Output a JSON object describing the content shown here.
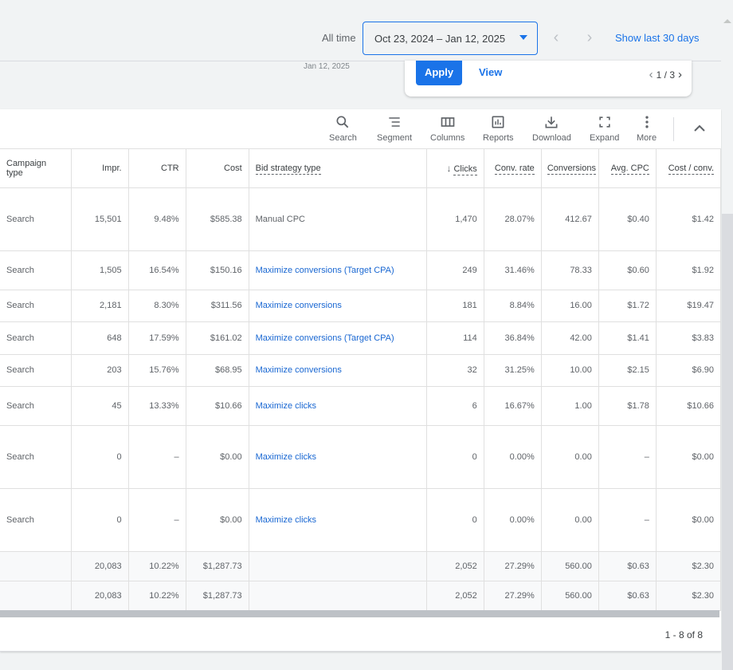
{
  "date_bar": {
    "preset_label": "All time",
    "range_value": "Oct 23, 2024 – Jan 12, 2025",
    "show_last_label": "Show last 30 days",
    "sub_date": "Jan 12, 2025"
  },
  "popup": {
    "apply_label": "Apply",
    "view_label": "View",
    "pager": "1 / 3"
  },
  "toolbar": {
    "items": [
      {
        "label": "Search",
        "icon": "search-icon"
      },
      {
        "label": "Segment",
        "icon": "segment-icon"
      },
      {
        "label": "Columns",
        "icon": "columns-icon"
      },
      {
        "label": "Reports",
        "icon": "reports-icon"
      },
      {
        "label": "Download",
        "icon": "download-icon"
      },
      {
        "label": "Expand",
        "icon": "expand-icon"
      },
      {
        "label": "More",
        "icon": "more-vert-icon"
      }
    ]
  },
  "table": {
    "columns": [
      "Campaign type",
      "Impr.",
      "CTR",
      "Cost",
      "Bid strategy type",
      "Clicks",
      "Conv. rate",
      "Conversions",
      "Avg. CPC",
      "Cost / conv."
    ],
    "sorted_column": "Clicks",
    "rows": [
      [
        "Search",
        "15,501",
        "9.48%",
        "$585.38",
        "Manual CPC",
        "1,470",
        "28.07%",
        "412.67",
        "$0.40",
        "$1.42"
      ],
      [
        "Search",
        "1,505",
        "16.54%",
        "$150.16",
        "Maximize conversions (Target CPA)",
        "249",
        "31.46%",
        "78.33",
        "$0.60",
        "$1.92"
      ],
      [
        "Search",
        "2,181",
        "8.30%",
        "$311.56",
        "Maximize conversions",
        "181",
        "8.84%",
        "16.00",
        "$1.72",
        "$19.47"
      ],
      [
        "Search",
        "648",
        "17.59%",
        "$161.02",
        "Maximize conversions (Target CPA)",
        "114",
        "36.84%",
        "42.00",
        "$1.41",
        "$3.83"
      ],
      [
        "Search",
        "203",
        "15.76%",
        "$68.95",
        "Maximize conversions",
        "32",
        "31.25%",
        "10.00",
        "$2.15",
        "$6.90"
      ],
      [
        "Search",
        "45",
        "13.33%",
        "$10.66",
        "Maximize clicks",
        "6",
        "16.67%",
        "1.00",
        "$1.78",
        "$10.66"
      ],
      [
        "Search",
        "0",
        "–",
        "$0.00",
        "Maximize clicks",
        "0",
        "0.00%",
        "0.00",
        "–",
        "$0.00"
      ],
      [
        "Search",
        "0",
        "–",
        "$0.00",
        "Maximize clicks",
        "0",
        "0.00%",
        "0.00",
        "–",
        "$0.00"
      ]
    ],
    "totals": [
      [
        "",
        "20,083",
        "10.22%",
        "$1,287.73",
        "",
        "2,052",
        "27.29%",
        "560.00",
        "$0.63",
        "$2.30"
      ],
      [
        "",
        "20,083",
        "10.22%",
        "$1,287.73",
        "",
        "2,052",
        "27.29%",
        "560.00",
        "$0.63",
        "$2.30"
      ]
    ]
  },
  "footer": {
    "row_count": "1 - 8 of 8"
  }
}
